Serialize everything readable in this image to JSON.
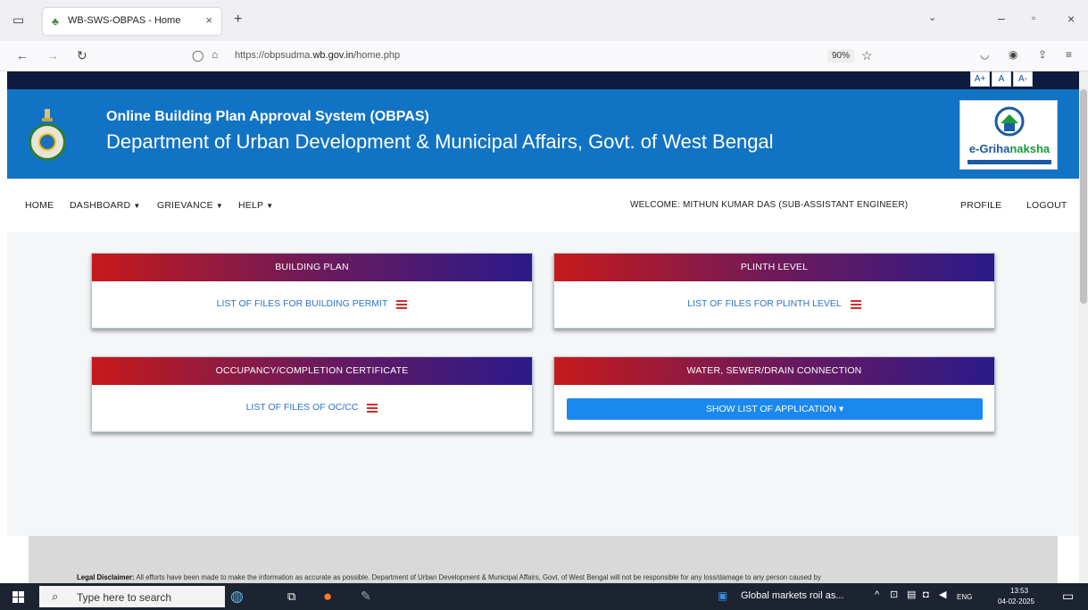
{
  "browser": {
    "tab_title": "WB-SWS-OBPAS - Home",
    "url_prefix": "https://obpsudma.",
    "url_domain": "wb.gov.in",
    "url_suffix": "/home.php",
    "zoom": "90%"
  },
  "page": {
    "font_buttons": [
      "A+",
      "A",
      "A-"
    ],
    "banner": {
      "title": "Online Building Plan Approval System (OBPAS)",
      "subtitle": "Department of Urban Development & Municipal Affairs, Govt. of West Bengal",
      "logo_part1": "e-Griha",
      "logo_part2": "naksha"
    },
    "menu": {
      "home": "HOME",
      "dashboard": "DASHBOARD",
      "grievance": "GRIEVANCE",
      "help": "HELP",
      "welcome": "WELCOME: MITHUN KUMAR DAS (SUB-ASSISTANT ENGINEER)",
      "profile": "PROFILE",
      "logout": "LOGOUT"
    },
    "cards": [
      {
        "title": "BUILDING PLAN",
        "link": "LIST OF FILES FOR BUILDING PERMIT"
      },
      {
        "title": "PLINTH LEVEL",
        "link": "LIST OF FILES FOR PLINTH LEVEL"
      },
      {
        "title": "OCCUPANCY/COMPLETION CERTIFICATE",
        "link": "LIST OF FILES OF OC/CC"
      },
      {
        "title": "WATER, SEWER/DRAIN CONNECTION",
        "button": "SHOW LIST OF APPLICATION ▾"
      }
    ],
    "disclaimer_label": "Legal Disclaimer:",
    "disclaimer_text": " All efforts have been made to make the information as accurate as possible. Department of Urban Development & Municipal Affairs, Govt. of West Bengal will not be responsible for any loss/damage to any person caused by"
  },
  "taskbar": {
    "search_placeholder": "Type here to search",
    "news": "Global markets roil as...",
    "lang": "ENG",
    "time": "13:53",
    "date": "04-02-2025"
  }
}
